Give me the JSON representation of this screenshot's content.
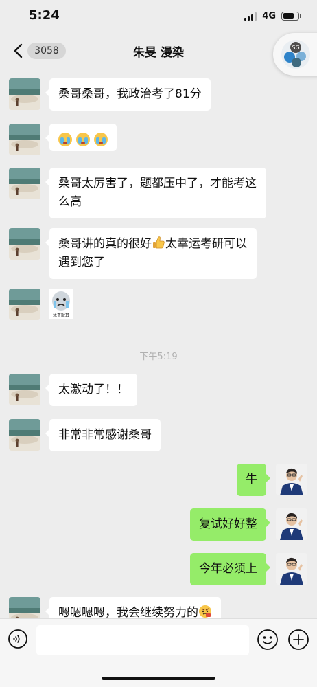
{
  "status_bar": {
    "time": "5:24",
    "network": "4G"
  },
  "nav": {
    "unread_count": "3058",
    "title": "朱旻 漫染"
  },
  "messages": {
    "m1": "桑哥桑哥，我政治考了81分",
    "m3": "桑哥太厉害了，题都压中了，才能考这么高",
    "m4a": "桑哥讲的真的很好",
    "m4b": "太幸运考研可以遇到您了",
    "m6": "太激动了！！",
    "m7": "非常非常感谢桑哥",
    "m8": "牛",
    "m9": "复试好好整",
    "m10": "今年必须上",
    "m11": "嗯嗯嗯嗯，我会继续努力的"
  },
  "time_divider": "下午5:19",
  "sticker_caption": "泳哥耿耳",
  "floating_widget_label": "SG",
  "icons": {
    "back": "chevron-left-icon",
    "voice": "voice-icon",
    "emoji": "smiley-icon",
    "more": "plus-icon",
    "thumbs_up": "thumbs-up-emoji",
    "crying": "crying-emoji",
    "proud": "proud-face-emoji"
  },
  "colors": {
    "background": "#ededed",
    "bubble_self": "#95ec69",
    "bubble_other": "#ffffff",
    "timestamp": "#b0b0b0"
  }
}
